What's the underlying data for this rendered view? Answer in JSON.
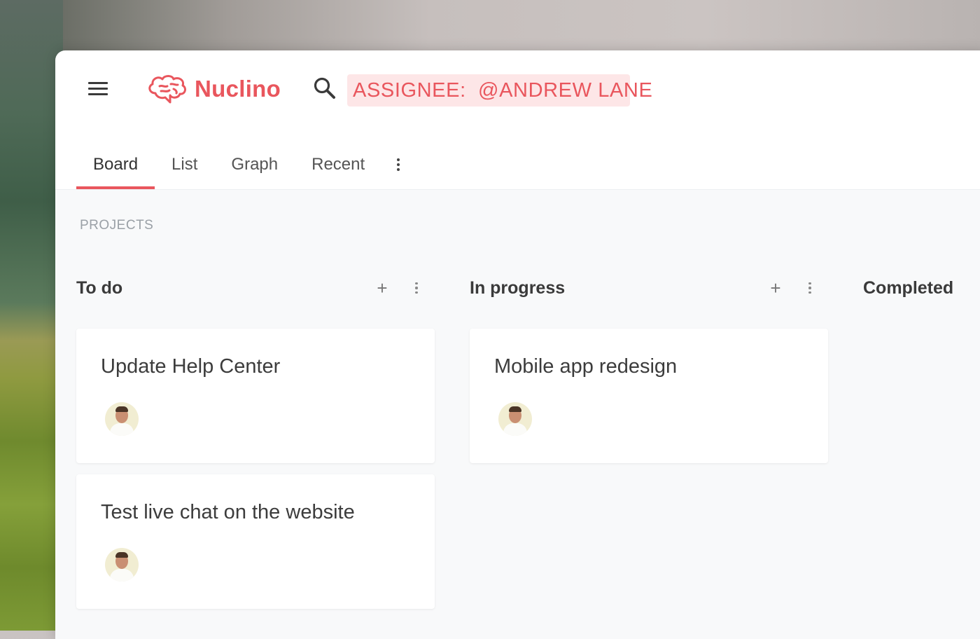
{
  "app": {
    "name": "Nuclino",
    "brand_color": "#e9565d"
  },
  "search": {
    "value": "ASSIGNEE:  @ANDREW LANE"
  },
  "tabs": [
    {
      "label": "Board",
      "active": true
    },
    {
      "label": "List",
      "active": false
    },
    {
      "label": "Graph",
      "active": false
    },
    {
      "label": "Recent",
      "active": false
    }
  ],
  "section": {
    "label": "PROJECTS"
  },
  "columns": [
    {
      "title": "To do",
      "cards": [
        {
          "title": "Update Help Center"
        },
        {
          "title": "Test live chat on the website"
        }
      ]
    },
    {
      "title": "In progress",
      "cards": [
        {
          "title": "Mobile app redesign"
        }
      ]
    },
    {
      "title": "Completed",
      "cards": []
    }
  ],
  "icons": {
    "menu": "menu-icon",
    "logo": "brain-icon",
    "search": "search-icon",
    "more": "more-vertical-icon",
    "add": "plus-icon"
  },
  "plus_glyph": "+"
}
